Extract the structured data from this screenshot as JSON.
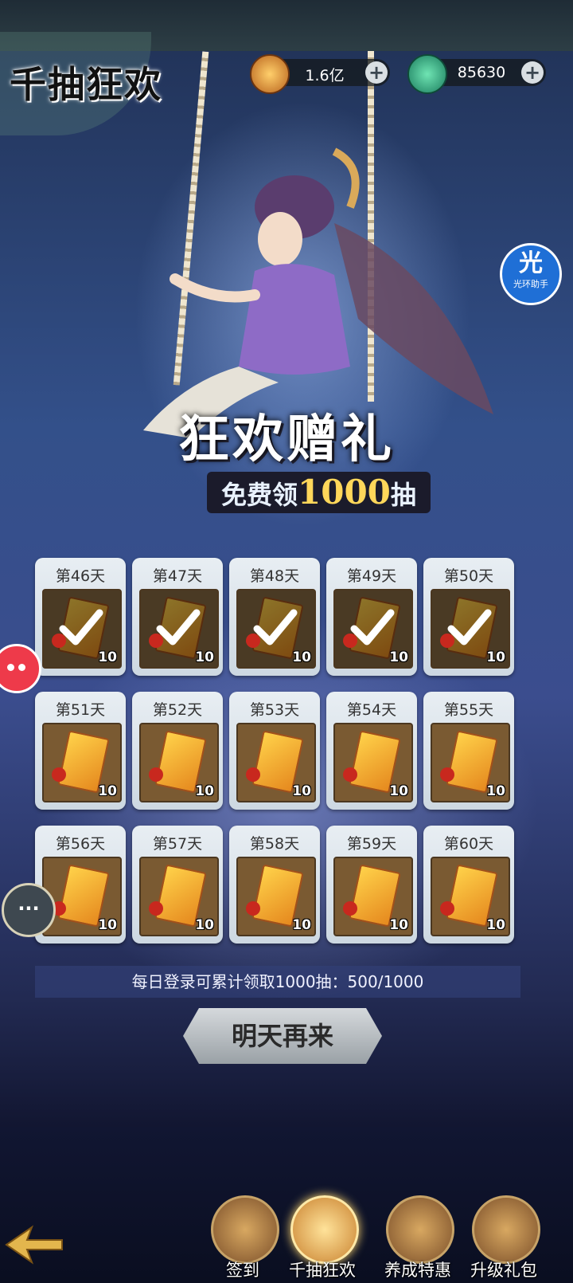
{
  "title": "千抽狂欢",
  "currencies": [
    {
      "icon": "copper-coin-icon",
      "value": "1.6亿",
      "plus_label": "+"
    },
    {
      "icon": "jade-dragon-icon",
      "value": "85630",
      "plus_label": "+"
    }
  ],
  "halo_assistant": {
    "glyph": "光",
    "label": "光环助手"
  },
  "banner": {
    "main": "狂欢赠礼",
    "sub_prefix": "免费领",
    "sub_number": "1000",
    "sub_suffix": "抽"
  },
  "days": [
    {
      "label": "第46天",
      "qty": "10",
      "claimed": true
    },
    {
      "label": "第47天",
      "qty": "10",
      "claimed": true
    },
    {
      "label": "第48天",
      "qty": "10",
      "claimed": true
    },
    {
      "label": "第49天",
      "qty": "10",
      "claimed": true
    },
    {
      "label": "第50天",
      "qty": "10",
      "claimed": true
    },
    {
      "label": "第51天",
      "qty": "10",
      "claimed": false
    },
    {
      "label": "第52天",
      "qty": "10",
      "claimed": false
    },
    {
      "label": "第53天",
      "qty": "10",
      "claimed": false
    },
    {
      "label": "第54天",
      "qty": "10",
      "claimed": false
    },
    {
      "label": "第55天",
      "qty": "10",
      "claimed": false
    },
    {
      "label": "第56天",
      "qty": "10",
      "claimed": false
    },
    {
      "label": "第57天",
      "qty": "10",
      "claimed": false
    },
    {
      "label": "第58天",
      "qty": "10",
      "claimed": false
    },
    {
      "label": "第59天",
      "qty": "10",
      "claimed": false
    },
    {
      "label": "第60天",
      "qty": "10",
      "claimed": false
    }
  ],
  "progress_text": "每日登录可累计领取1000抽：500/1000",
  "action_button": "明天再来",
  "side_chat_label": "···",
  "bottom_nav": [
    {
      "label": "签到",
      "icon": "sign-in-scroll-icon",
      "active": false
    },
    {
      "label": "千抽狂欢",
      "icon": "gift-chest-icon",
      "active": true
    },
    {
      "label": "养成特惠",
      "icon": "treasure-box-icon",
      "active": false
    },
    {
      "label": "升级礼包",
      "icon": "gift-pot-icon",
      "active": false
    }
  ],
  "colors": {
    "accent_gold": "#ffd75a",
    "badge_red": "#ee3a4a",
    "halo_blue": "#1f6fd6"
  }
}
